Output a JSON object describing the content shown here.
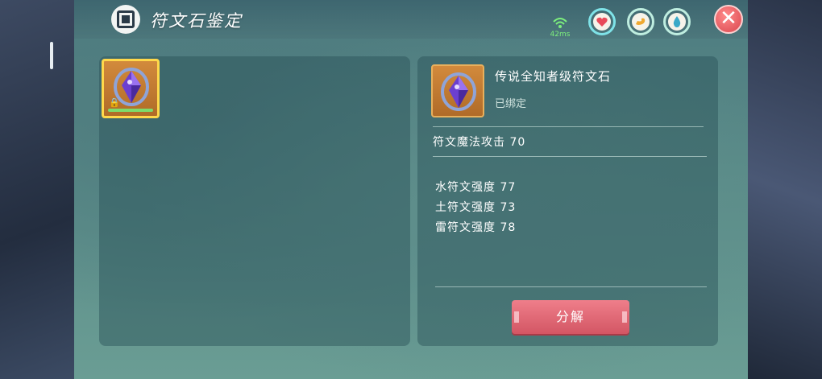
{
  "window": {
    "title": "符文石鉴定"
  },
  "status": {
    "ping_label": "42ms",
    "icons": [
      "wifi-icon",
      "heart-icon",
      "arm-icon",
      "water-drop-icon"
    ]
  },
  "inventory": {
    "slots": [
      {
        "icon": "purple-rune-stone-icon",
        "locked": true
      }
    ]
  },
  "detail": {
    "name": "传说全知者级符文石",
    "bound_status": "已绑定",
    "main_stat": "符文魔法攻击 70",
    "sub_stats": [
      "水符文强度 77",
      "土符文强度 73",
      "雷符文强度 78"
    ]
  },
  "actions": {
    "decompose_label": "分解",
    "close_label": "✕"
  },
  "colors": {
    "accent_gold": "#ffd84a",
    "button_red": "#d35664",
    "ping_green": "#7df07d"
  }
}
